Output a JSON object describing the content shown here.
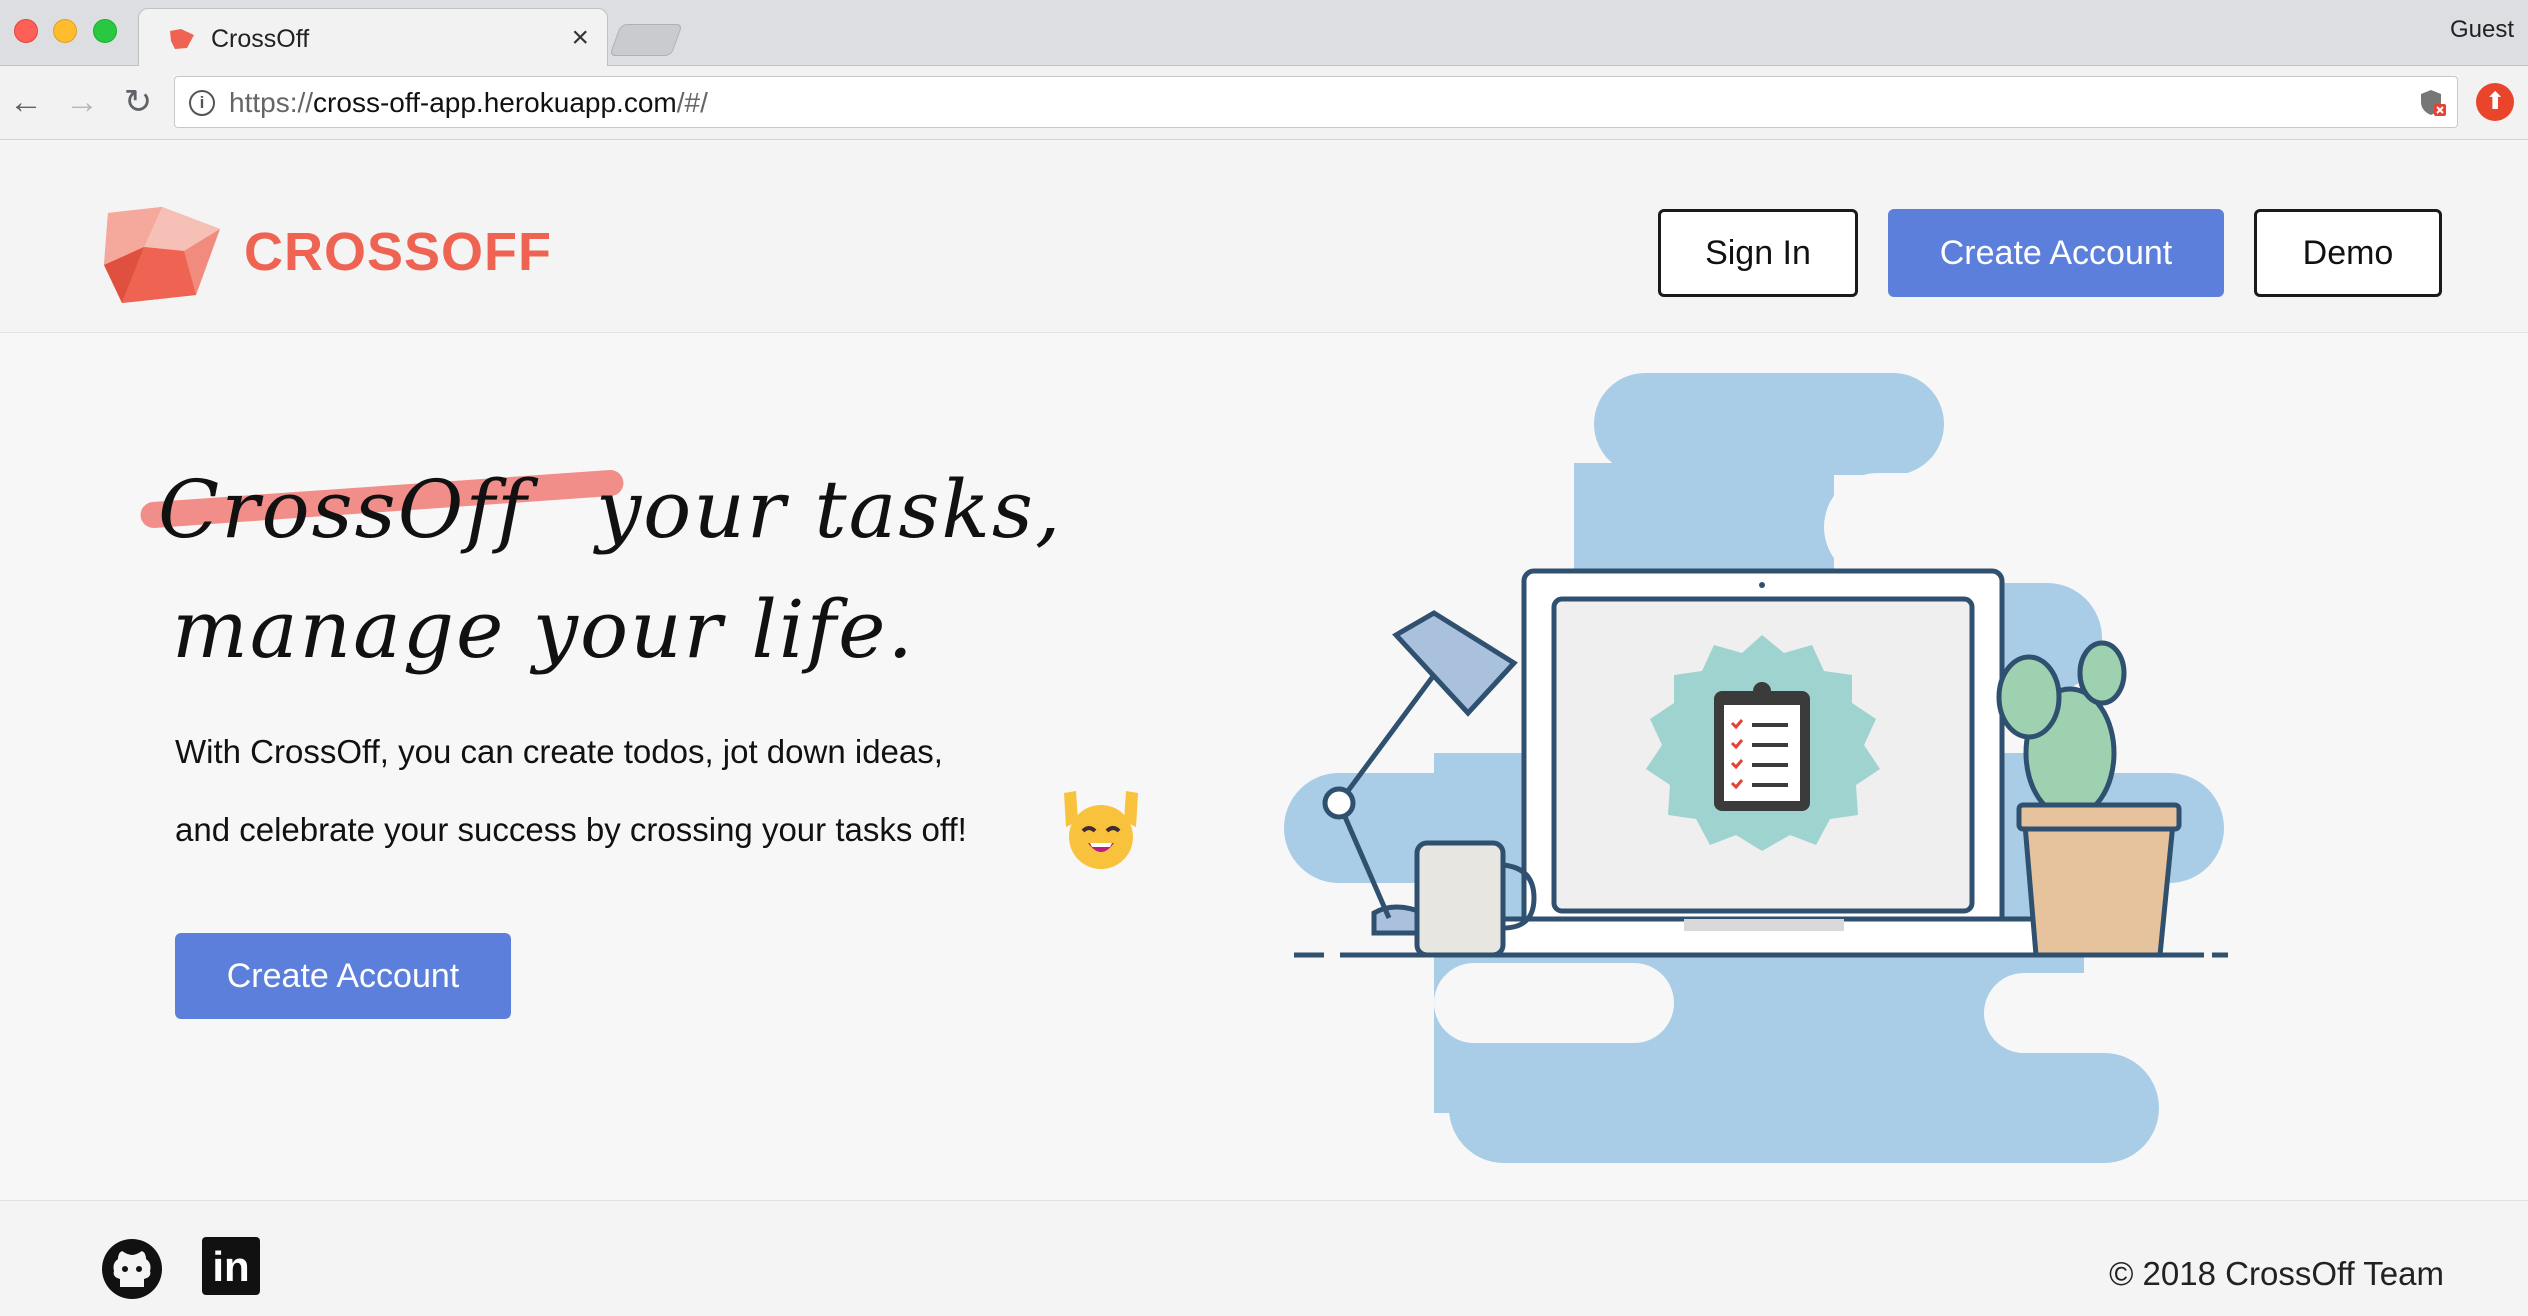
{
  "browser": {
    "tab_title": "CrossOff",
    "tab_close": "×",
    "profile": "Guest",
    "url_scheme": "https://",
    "url_host": "cross-off-app.herokuapp.com",
    "url_path": "/#/",
    "icons": [
      "back-icon",
      "forward-icon",
      "reload-icon",
      "info-icon",
      "shield-icon",
      "extension-icon"
    ]
  },
  "header": {
    "brand": "CROSSOFF",
    "sign_in": "Sign In",
    "create_account": "Create Account",
    "demo": "Demo"
  },
  "hero": {
    "struck_word": "CrossOff",
    "line1_rest": "your tasks,",
    "line2": "manage your life.",
    "desc_line1": "With CrossOff, you can create todos, jot down ideas,",
    "desc_line2": "and celebrate your success by crossing your tasks off!",
    "cta": "Create Account"
  },
  "footer": {
    "copyright": "© 2018 CrossOff Team",
    "linkedin_glyph": "in",
    "icons": [
      "github-icon",
      "linkedin-icon"
    ]
  },
  "colors": {
    "brand_red": "#ee6352",
    "primary_blue": "#5b7fdb",
    "illustration_blue": "#a9cde6"
  }
}
